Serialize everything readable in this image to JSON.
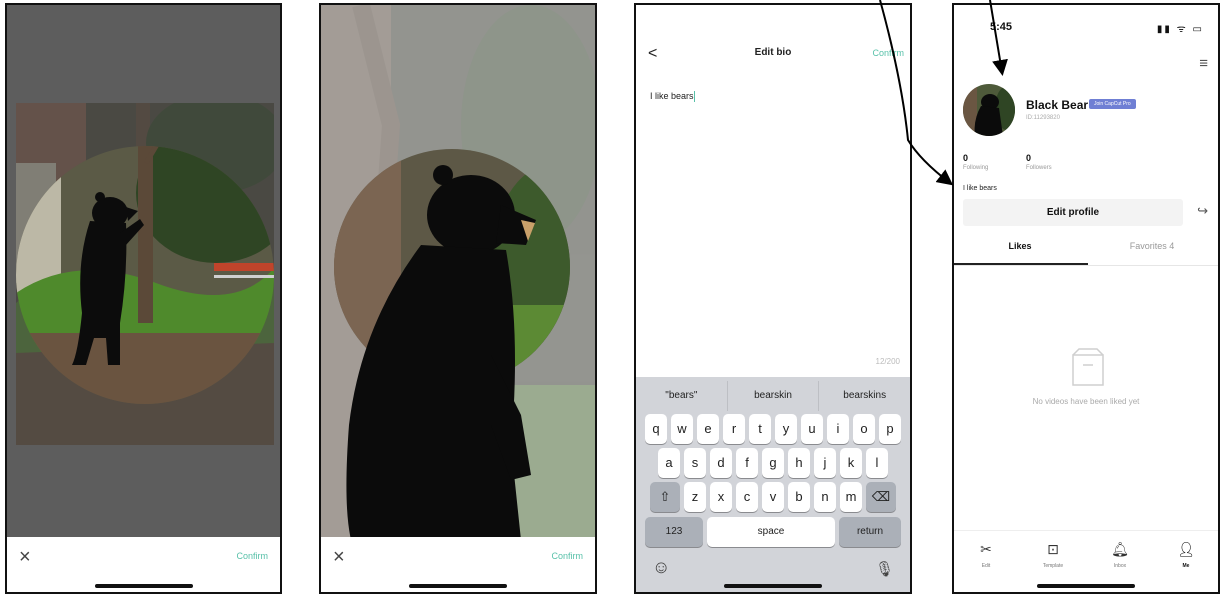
{
  "screen1": {
    "confirm_label": "Confirm",
    "close_glyph": "×"
  },
  "screen2": {
    "confirm_label": "Confirm",
    "close_glyph": "×"
  },
  "edit_bio": {
    "back_glyph": "<",
    "title": "Edit bio",
    "confirm_label": "Confirm",
    "bio_text": "I like bears",
    "char_counter": "12/200",
    "suggestions": [
      "\"bears\"",
      "bearskin",
      "bearskins"
    ],
    "keys_row1": [
      "q",
      "w",
      "e",
      "r",
      "t",
      "y",
      "u",
      "i",
      "o",
      "p"
    ],
    "keys_row2": [
      "a",
      "s",
      "d",
      "f",
      "g",
      "h",
      "j",
      "k",
      "l"
    ],
    "keys_row3": [
      "z",
      "x",
      "c",
      "v",
      "b",
      "n",
      "m"
    ],
    "key_numbers": "123",
    "key_space": "space",
    "key_return": "return",
    "icons": [
      "emoji-icon",
      "microphone-icon",
      "shift-icon",
      "backspace-icon"
    ]
  },
  "profile": {
    "time": "5:45",
    "status_icons": "▮▮ ᯤ ▭",
    "name": "Black Bear",
    "pro_badge": "Join CapCut Pro",
    "user_id": "ID:11293820",
    "following_count": "0",
    "following_label": "Following",
    "followers_count": "0",
    "followers_label": "Followers",
    "bio": "I like bears",
    "edit_profile_label": "Edit profile",
    "tab_likes": "Likes",
    "tab_favorites": "Favorites 4",
    "empty_state": "No videos have been liked yet",
    "nav": [
      {
        "label": "Edit",
        "icon": "scissors-icon"
      },
      {
        "label": "Template",
        "icon": "template-icon"
      },
      {
        "label": "Inbox",
        "icon": "bell-icon"
      },
      {
        "label": "Me",
        "icon": "person-icon"
      }
    ]
  }
}
